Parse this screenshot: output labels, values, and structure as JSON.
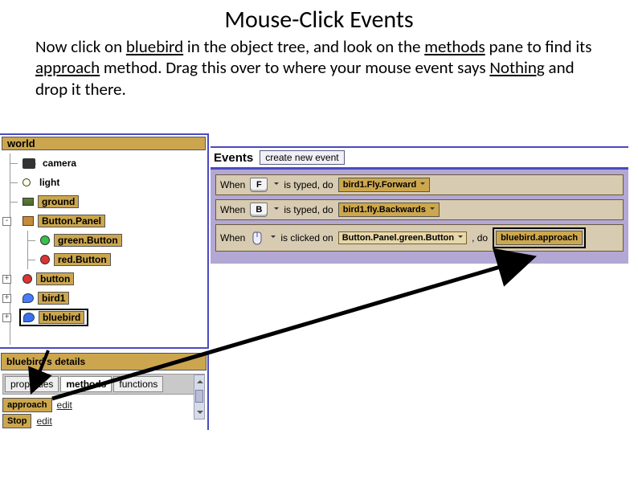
{
  "title": "Mouse-Click Events",
  "instruction": {
    "p1": "Now click on ",
    "bluebird": "bluebird",
    "p2": " in the object tree, and look on the ",
    "methods": "methods",
    "p3": " pane to find its ",
    "approach": "approach",
    "p4": " method. Drag this over to where your mouse event says ",
    "nothing": "Nothing",
    "p5": " and drop it there."
  },
  "tree": {
    "root": "world",
    "items": [
      "camera",
      "light",
      "ground",
      "Button.Panel",
      "green.Button",
      "red.Button",
      "button",
      "bird1",
      "bluebird"
    ]
  },
  "details": {
    "header": "bluebird's details",
    "tabs": {
      "properties": "properties",
      "methods": "methods",
      "functions": "functions"
    },
    "methods": {
      "approach": "approach",
      "stop": "Stop"
    },
    "edit": "edit"
  },
  "events": {
    "title": "Events",
    "create": "create new event",
    "rows": [
      {
        "prefix": "When",
        "key": "F",
        "mid": "is typed, do",
        "action": "bird1.Fly.Forward"
      },
      {
        "prefix": "When",
        "key": "B",
        "mid": "is typed, do",
        "action": "bird1.fly.Backwards"
      },
      {
        "prefix": "When",
        "mid1": "is clicked on",
        "target": "Button.Panel.green.Button",
        "mid2": ", do",
        "action": "bluebird.approach"
      }
    ]
  }
}
